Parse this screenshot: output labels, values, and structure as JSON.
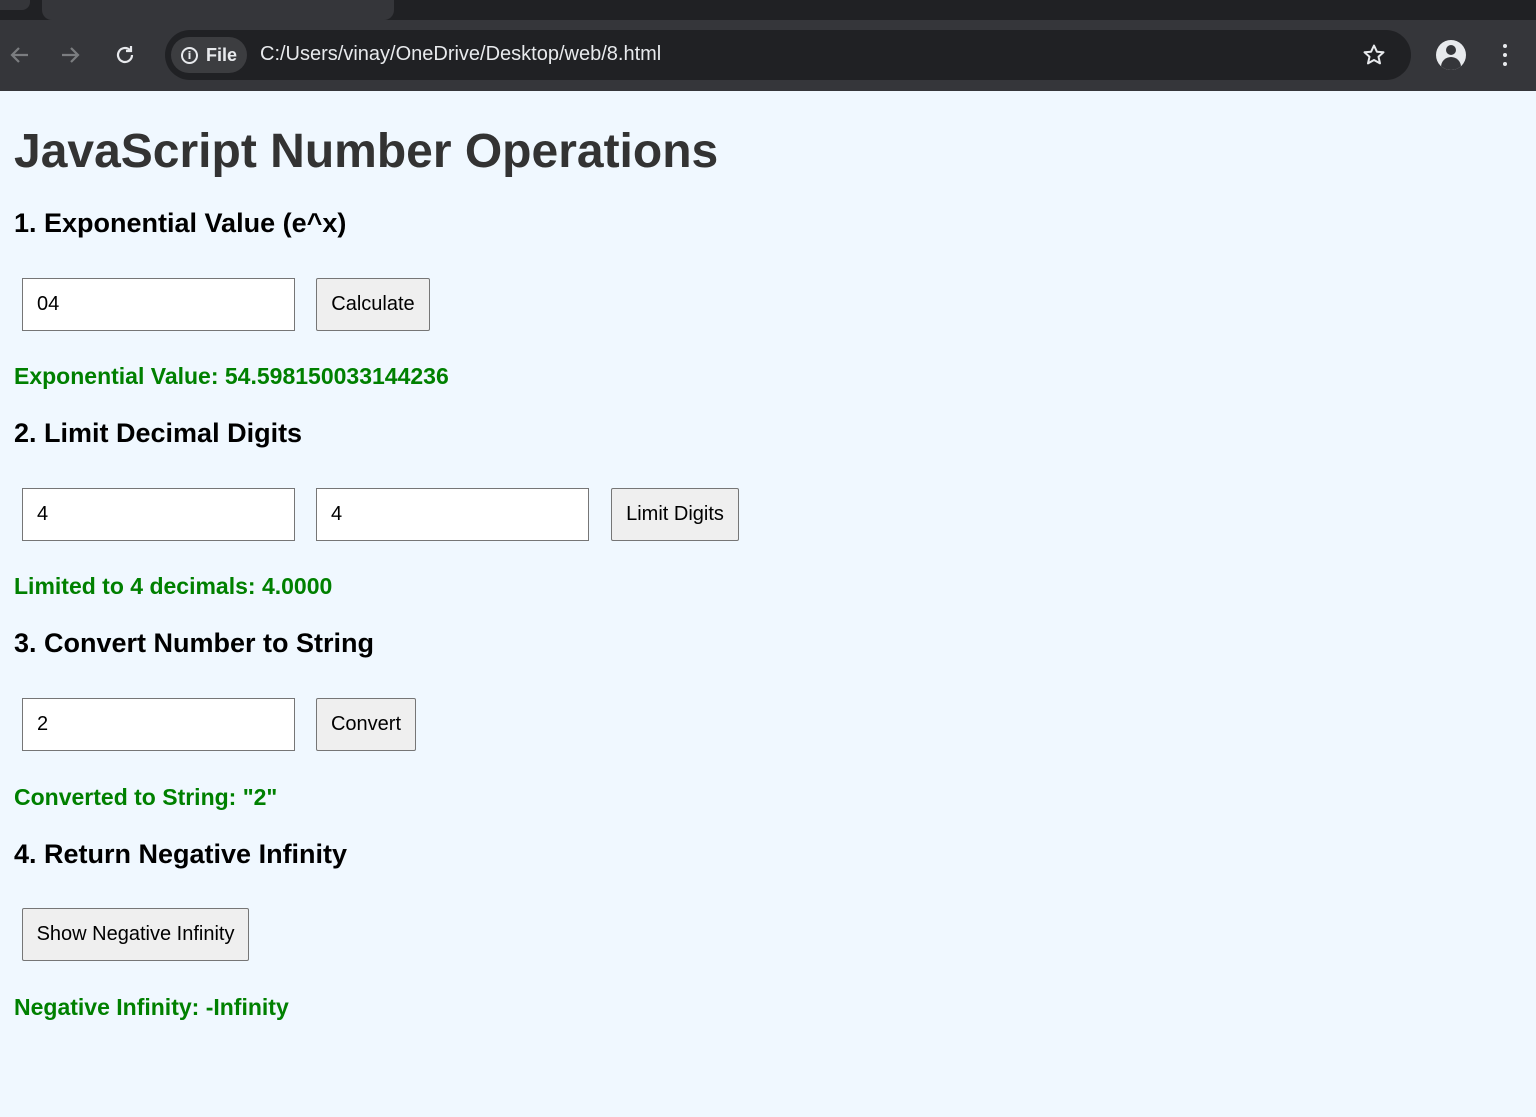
{
  "browser": {
    "url": "C:/Users/vinay/OneDrive/Desktop/web/8.html",
    "site_chip_label": "File"
  },
  "page": {
    "title": "JavaScript Number Operations",
    "sections": [
      {
        "heading": "1. Exponential Value (e^x)",
        "input_value": "04",
        "button_label": "Calculate",
        "result": "Exponential Value: 54.598150033144236"
      },
      {
        "heading": "2. Limit Decimal Digits",
        "input_value": "4",
        "input2_value": "4",
        "button_label": "Limit Digits",
        "result": "Limited to 4 decimals: 4.0000"
      },
      {
        "heading": "3. Convert Number to String",
        "input_value": "2",
        "button_label": "Convert",
        "result": "Converted to String: \"2\""
      },
      {
        "heading": "4. Return Negative Infinity",
        "button_label": "Show Negative Infinity",
        "result": "Negative Infinity: -Infinity"
      }
    ]
  },
  "colors": {
    "page_background": "#f0f8ff",
    "title": "#333333",
    "result_text": "#008000",
    "browser_toolbar": "#35363a"
  }
}
